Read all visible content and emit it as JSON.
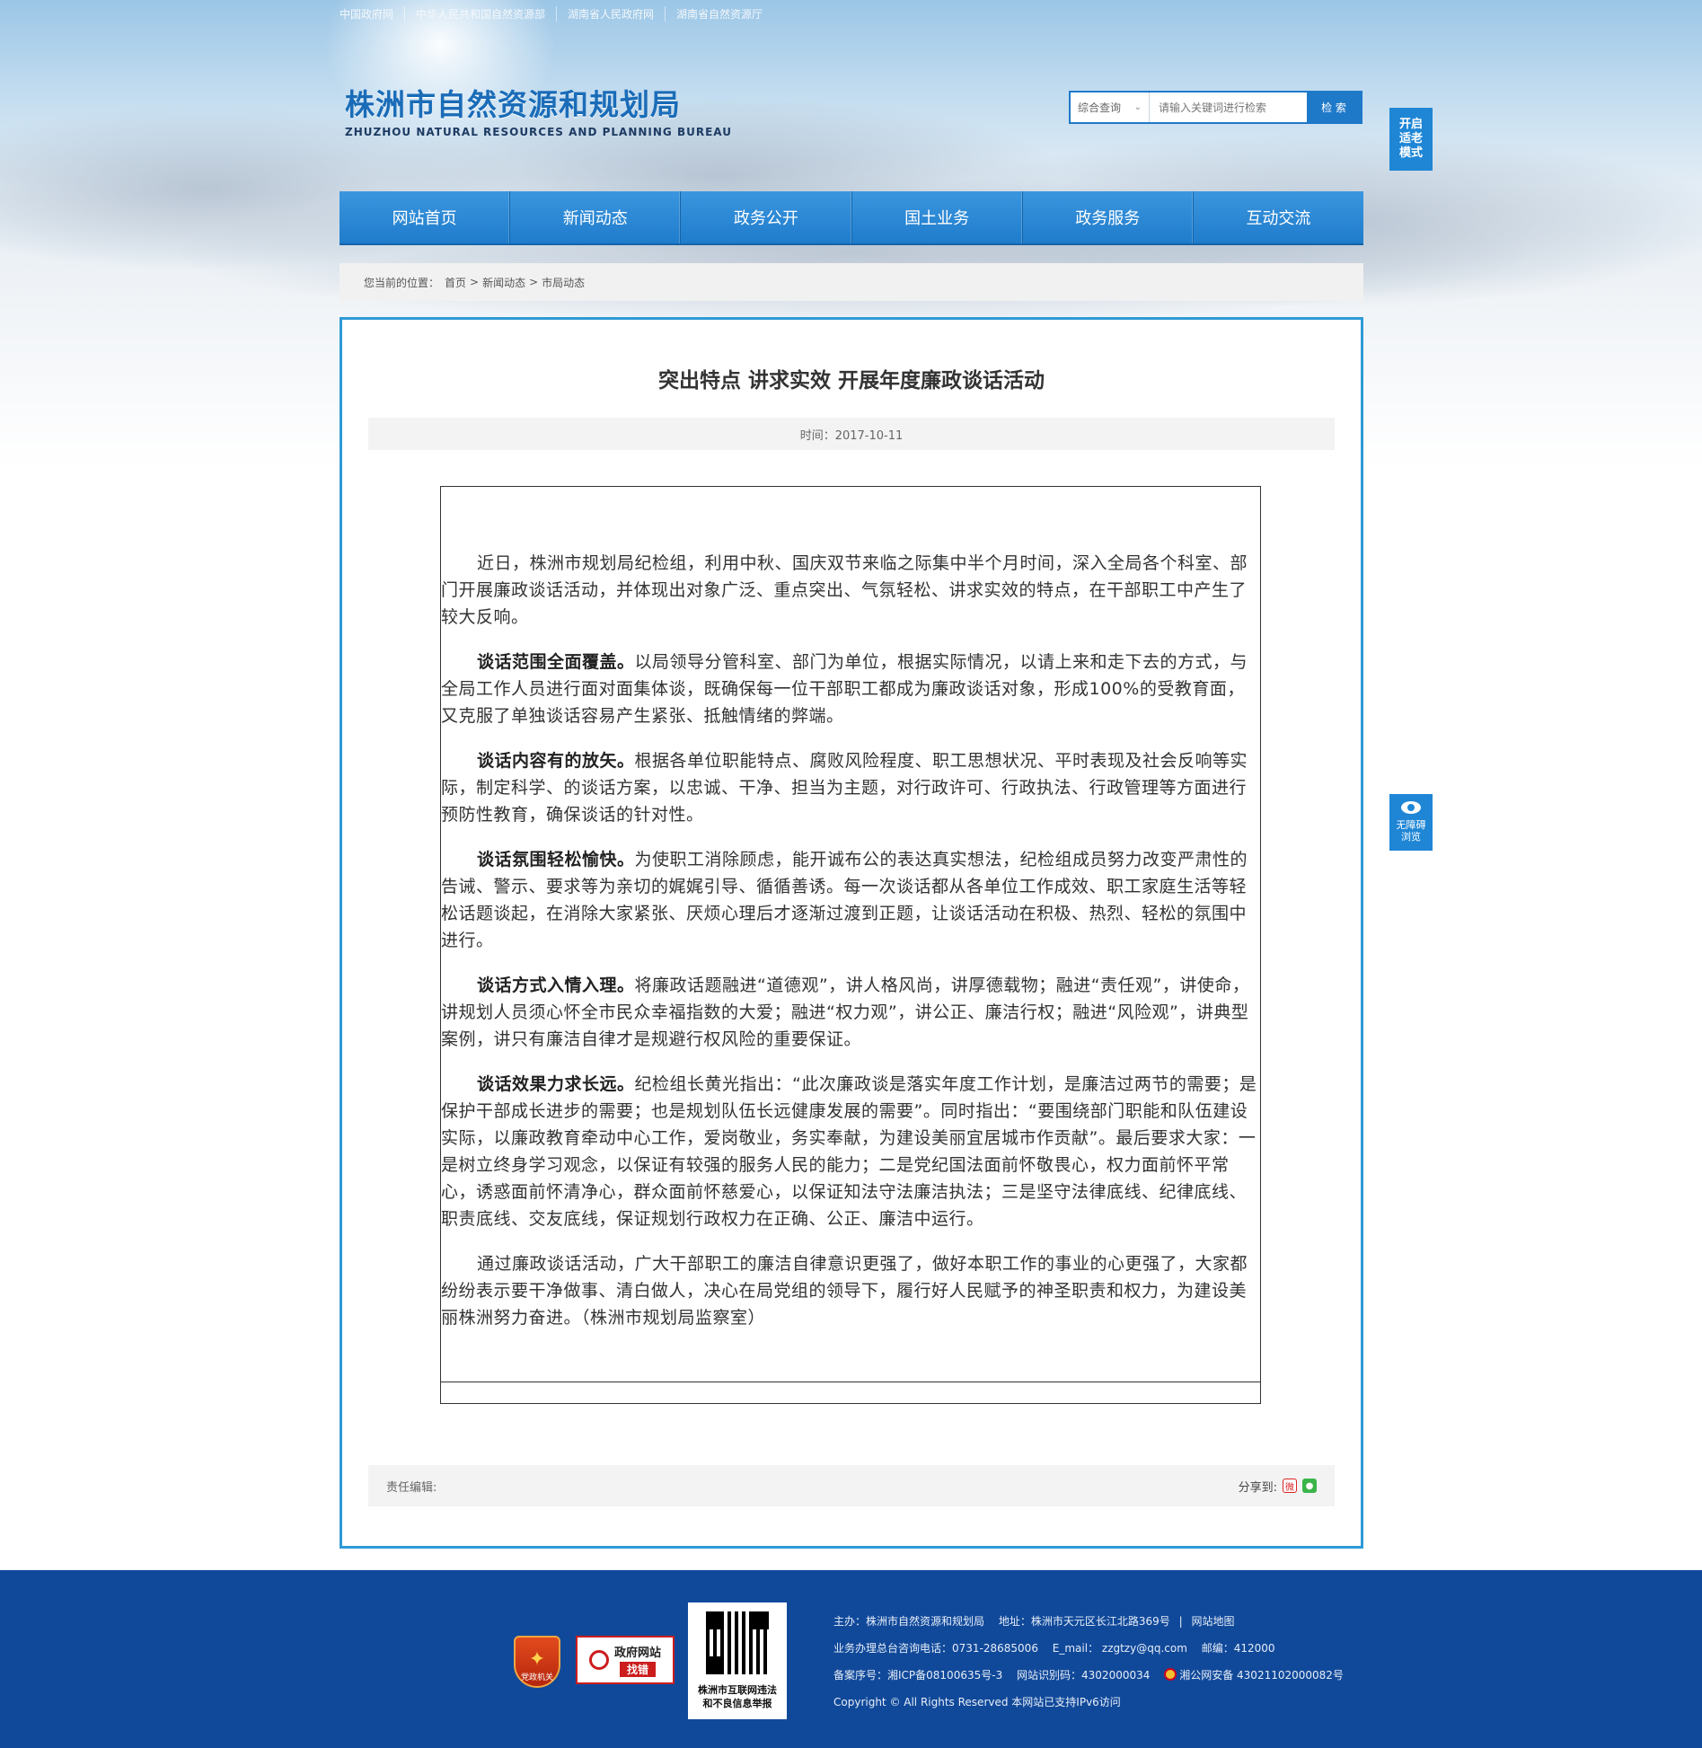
{
  "top_links": [
    "中国政府网",
    "中华人民共和国自然资源部",
    "湖南省人民政府网",
    "湖南省自然资源厅"
  ],
  "logo": {
    "cn": "株洲市自然资源和规划局",
    "en": "ZHUZHOU NATURAL RESOURCES AND PLANNING BUREAU"
  },
  "search": {
    "scope": "综合查询",
    "placeholder": "请输入关键词进行检索",
    "button": "检 索"
  },
  "elder_mode": "开启适老模式",
  "accessible": "无障碍浏览",
  "nav": [
    "网站首页",
    "新闻动态",
    "政务公开",
    "国土业务",
    "政务服务",
    "互动交流"
  ],
  "breadcrumb": {
    "label": "您当前的位置：",
    "items": [
      "首页",
      "新闻动态",
      "市局动态"
    ],
    "sep": ">"
  },
  "article": {
    "title": "突出特点 讲求实效 开展年度廉政谈话活动",
    "time": "时间：2017-10-11",
    "paragraphs": [
      {
        "lead": "",
        "text": "近日，株洲市规划局纪检组，利用中秋、国庆双节来临之际集中半个月时间，深入全局各个科室、部门开展廉政谈话活动，并体现出对象广泛、重点突出、气氛轻松、讲求实效的特点，在干部职工中产生了较大反响。"
      },
      {
        "lead": "谈话范围全面覆盖。",
        "text": "以局领导分管科室、部门为单位，根据实际情况，以请上来和走下去的方式，与全局工作人员进行面对面集体谈，既确保每一位干部职工都成为廉政谈话对象，形成100%的受教育面，又克服了单独谈话容易产生紧张、抵触情绪的弊端。"
      },
      {
        "lead": "谈话内容有的放矢。",
        "text": "根据各单位职能特点、腐败风险程度、职工思想状况、平时表现及社会反响等实际，制定科学、的谈话方案，以忠诚、干净、担当为主题，对行政许可、行政执法、行政管理等方面进行预防性教育，确保谈话的针对性。"
      },
      {
        "lead": "谈话氛围轻松愉快。",
        "text": "为使职工消除顾虑，能开诚布公的表达真实想法，纪检组成员努力改变严肃性的告诫、警示、要求等为亲切的娓娓引导、循循善诱。每一次谈话都从各单位工作成效、职工家庭生活等轻松话题谈起，在消除大家紧张、厌烦心理后才逐渐过渡到正题，让谈话活动在积极、热烈、轻松的氛围中进行。"
      },
      {
        "lead": "谈话方式入情入理。",
        "text": "将廉政话题融进“道德观”，讲人格风尚，讲厚德载物；融进“责任观”，讲使命，讲规划人员须心怀全市民众幸福指数的大爱；融进“权力观”，讲公正、廉洁行权；融进“风险观”，讲典型案例，讲只有廉洁自律才是规避行权风险的重要保证。"
      },
      {
        "lead": "谈话效果力求长远。",
        "text": "纪检组长黄光指出：“此次廉政谈是落实年度工作计划，是廉洁过两节的需要；是保护干部成长进步的需要；也是规划队伍长远健康发展的需要”。同时指出：“要围绕部门职能和队伍建设实际，以廉政教育牵动中心工作，爱岗敬业，务实奉献，为建设美丽宜居城市作贡献”。最后要求大家：一是树立终身学习观念，以保证有较强的服务人民的能力；二是党纪国法面前怀敬畏心，权力面前怀平常心，诱惑面前怀清净心，群众面前怀慈爱心，以保证知法守法廉洁执法；三是坚守法律底线、纪律底线、职责底线、交友底线，保证规划行政权力在正确、公正、廉洁中运行。"
      },
      {
        "lead": "",
        "text": "通过廉政谈话活动，广大干部职工的廉洁自律意识更强了，做好本职工作的事业的心更强了，大家都纷纷表示要干净做事、清白做人，决心在局党组的领导下，履行好人民赋予的神圣职责和权力，为建设美丽株洲努力奋进。（株洲市规划局监察室）"
      }
    ],
    "editor_label": "责任编辑:",
    "share_label": "分享到:"
  },
  "footer": {
    "badge1": "党政机关",
    "badge2_top": "政府网站",
    "badge2_bottom": "找错",
    "qr_caption": "株洲市互联网违法和不良信息举报",
    "host": "主办：株洲市自然资源和规划局",
    "address": "地址：株洲市天元区长江北路369号",
    "sitemap": "网站地图",
    "phone": "业务办理总台咨询电话：0731-28685006",
    "email": "E_mail： zzgtzy@qq.com",
    "postcode": "邮编：412000",
    "icp": "备案序号：湘ICP备08100635号-3",
    "site_id": "网站识别码：4302000034",
    "police": "湘公网安备 43021102000082号",
    "copyright": "Copyright © All Rights Reserved 本网站已支持IPv6访问"
  },
  "colors": {
    "brand_blue": "#1f79c9",
    "frame_border": "#2e9ad6",
    "footer_bg": "#11499a"
  }
}
